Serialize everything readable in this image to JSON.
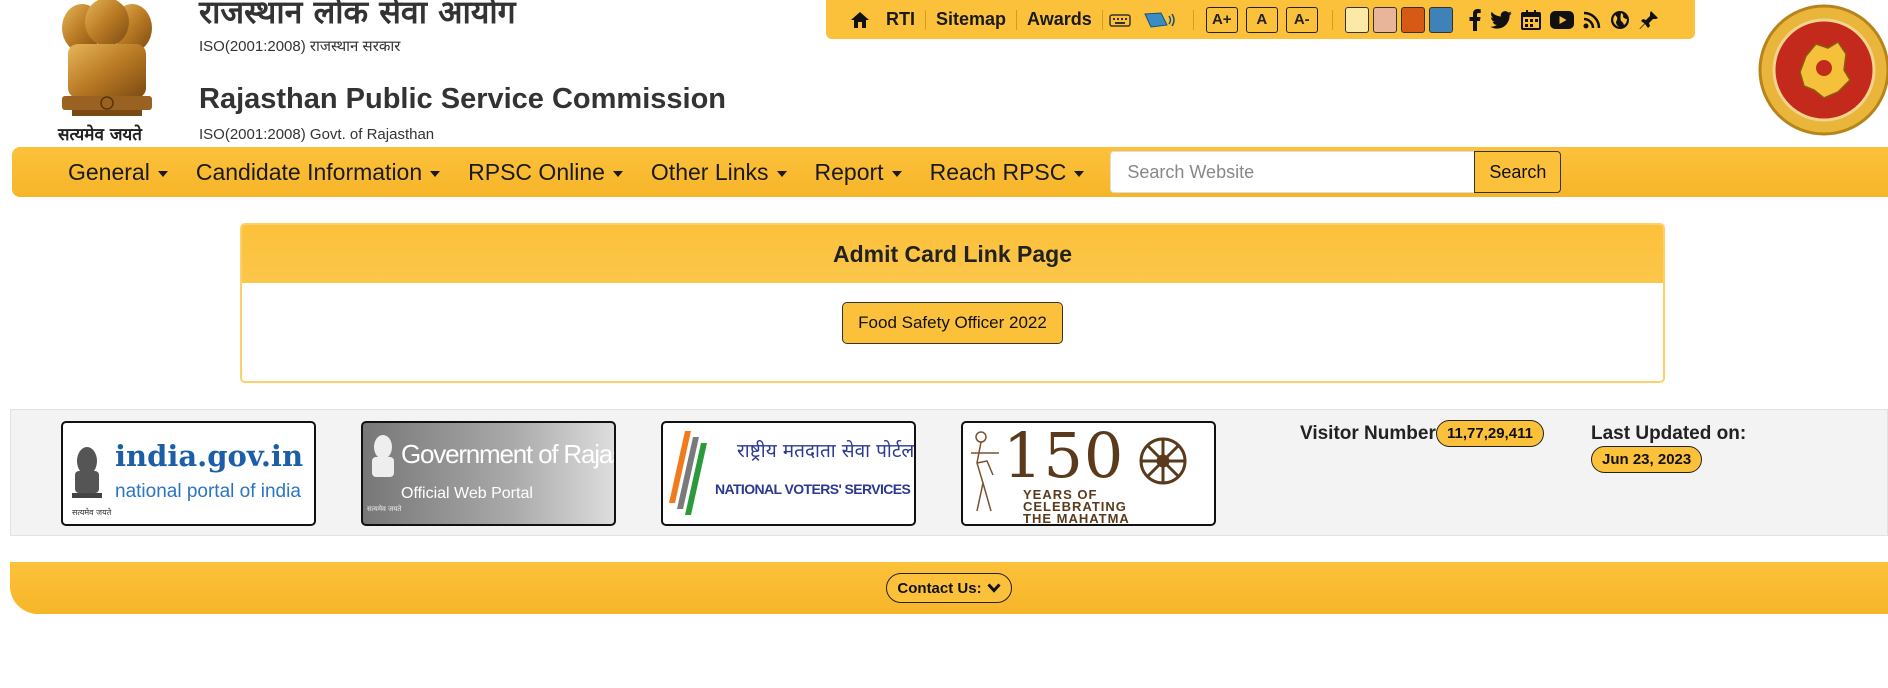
{
  "header": {
    "emblem_caption": "सत्यमेव जयते",
    "title_hindi": "राजस्थान लोक सेवा आयोग",
    "subtitle_hindi": "ISO(2001:2008) राजस्थान सरकार",
    "title_english": "Rajasthan Public Service Commission",
    "subtitle_english": "ISO(2001:2008) Govt. of Rajasthan"
  },
  "toolbar": {
    "items": [
      "RTI",
      "Sitemap",
      "Awards"
    ],
    "font_sizes": [
      "A+",
      "A",
      "A-"
    ],
    "themes": [
      "#fbe9a8",
      "#e9b59a",
      "#d65a16",
      "#3f82b8"
    ],
    "icons": {
      "home": "home-icon",
      "keyboard": "keyboard-icon",
      "screen_reader": "screen-reader-icon",
      "social": [
        "facebook-icon",
        "twitter-icon",
        "calendar-icon",
        "youtube-icon",
        "rss-icon",
        "globe-icon",
        "pin-icon"
      ]
    },
    "accent": "#fcc13b"
  },
  "nav": {
    "items": [
      "General",
      "Candidate Information",
      "RPSC Online",
      "Other Links",
      "Report",
      "Reach RPSC"
    ],
    "search_placeholder": "Search Website",
    "search_button": "Search"
  },
  "panel": {
    "title": "Admit Card Link Page",
    "button": "Food Safety Officer 2022"
  },
  "portal_links": {
    "india": {
      "title": "india.gov.in",
      "subtitle": "national portal of india",
      "emblem_text": "सत्यमेव जयते"
    },
    "rajasthan": {
      "title": "Government of Rajasthan",
      "subtitle": "Official Web Portal",
      "emblem_text": "सत्यमेव जयते"
    },
    "voters": {
      "title": "राष्ट्रीय मतदाता सेवा पोर्टल",
      "subtitle": "NATIONAL VOTERS' SERVICES PORTAL"
    },
    "mahatma": {
      "number": "150",
      "line1": "YEARS OF",
      "line2": "CELEBRATING",
      "line3": "THE MAHATMA"
    }
  },
  "stats": {
    "visitor_label": "Visitor Number:",
    "visitor_count": "11,77,29,411",
    "updated_label": "Last Updated on:",
    "updated_date": "Jun 23, 2023"
  },
  "footer": {
    "contact_label": "Contact Us:"
  }
}
